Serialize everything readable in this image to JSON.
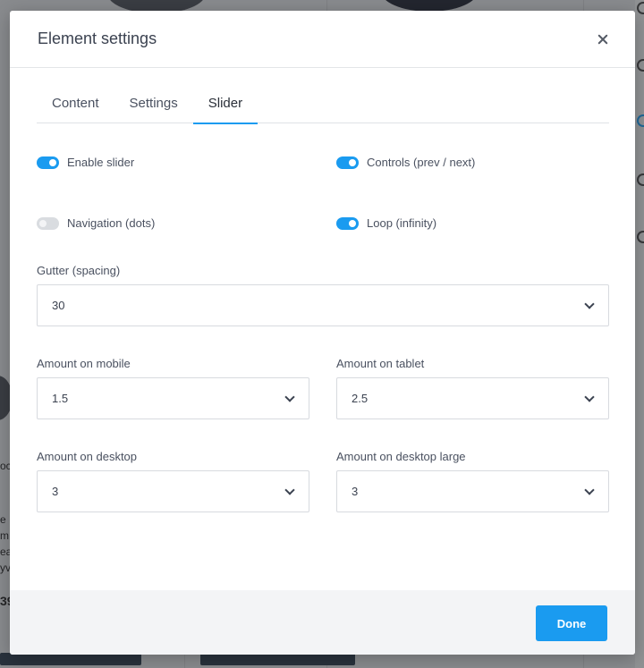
{
  "modal": {
    "title": "Element settings"
  },
  "tabs": [
    {
      "label": "Content",
      "active": false
    },
    {
      "label": "Settings",
      "active": false
    },
    {
      "label": "Slider",
      "active": true
    }
  ],
  "toggles": {
    "enable_slider": {
      "label": "Enable slider",
      "on": true
    },
    "controls": {
      "label": "Controls (prev / next)",
      "on": true
    },
    "navigation": {
      "label": "Navigation (dots)",
      "on": false
    },
    "loop": {
      "label": "Loop (infinity)",
      "on": true
    }
  },
  "fields": {
    "gutter": {
      "label": "Gutter (spacing)",
      "value": "30"
    },
    "mobile": {
      "label": "Amount on mobile",
      "value": "1.5"
    },
    "tablet": {
      "label": "Amount on tablet",
      "value": "2.5"
    },
    "desktop": {
      "label": "Amount on desktop",
      "value": "3"
    },
    "desktop_large": {
      "label": "Amount on desktop large",
      "value": "3"
    }
  },
  "footer": {
    "done_label": "Done"
  },
  "background": {
    "edge_text": [
      "e",
      "m",
      "ea",
      "yv",
      "39",
      "oc"
    ]
  },
  "colors": {
    "accent": "#1a9bf0",
    "toggle_off": "#d9dce0",
    "footer_bg": "#f3f4f6"
  }
}
